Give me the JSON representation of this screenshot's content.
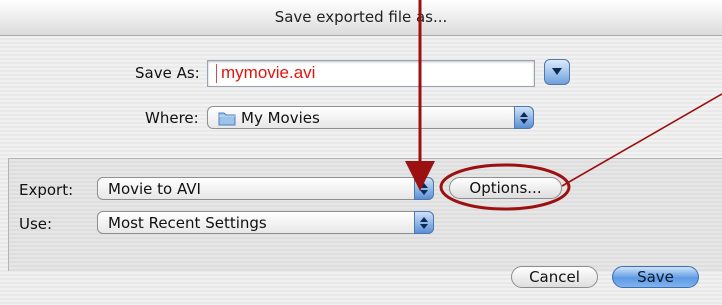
{
  "dialog": {
    "title": "Save exported file as..."
  },
  "save_as": {
    "label": "Save As:",
    "value": "mymovie.avi"
  },
  "where": {
    "label": "Where:",
    "value": "My Movies"
  },
  "export": {
    "label": "Export:",
    "value": "Movie to AVI"
  },
  "use": {
    "label": "Use:",
    "value": "Most Recent Settings"
  },
  "buttons": {
    "options": "Options...",
    "cancel": "Cancel",
    "save": "Save"
  },
  "annotation": {
    "color": "#9b1111"
  }
}
